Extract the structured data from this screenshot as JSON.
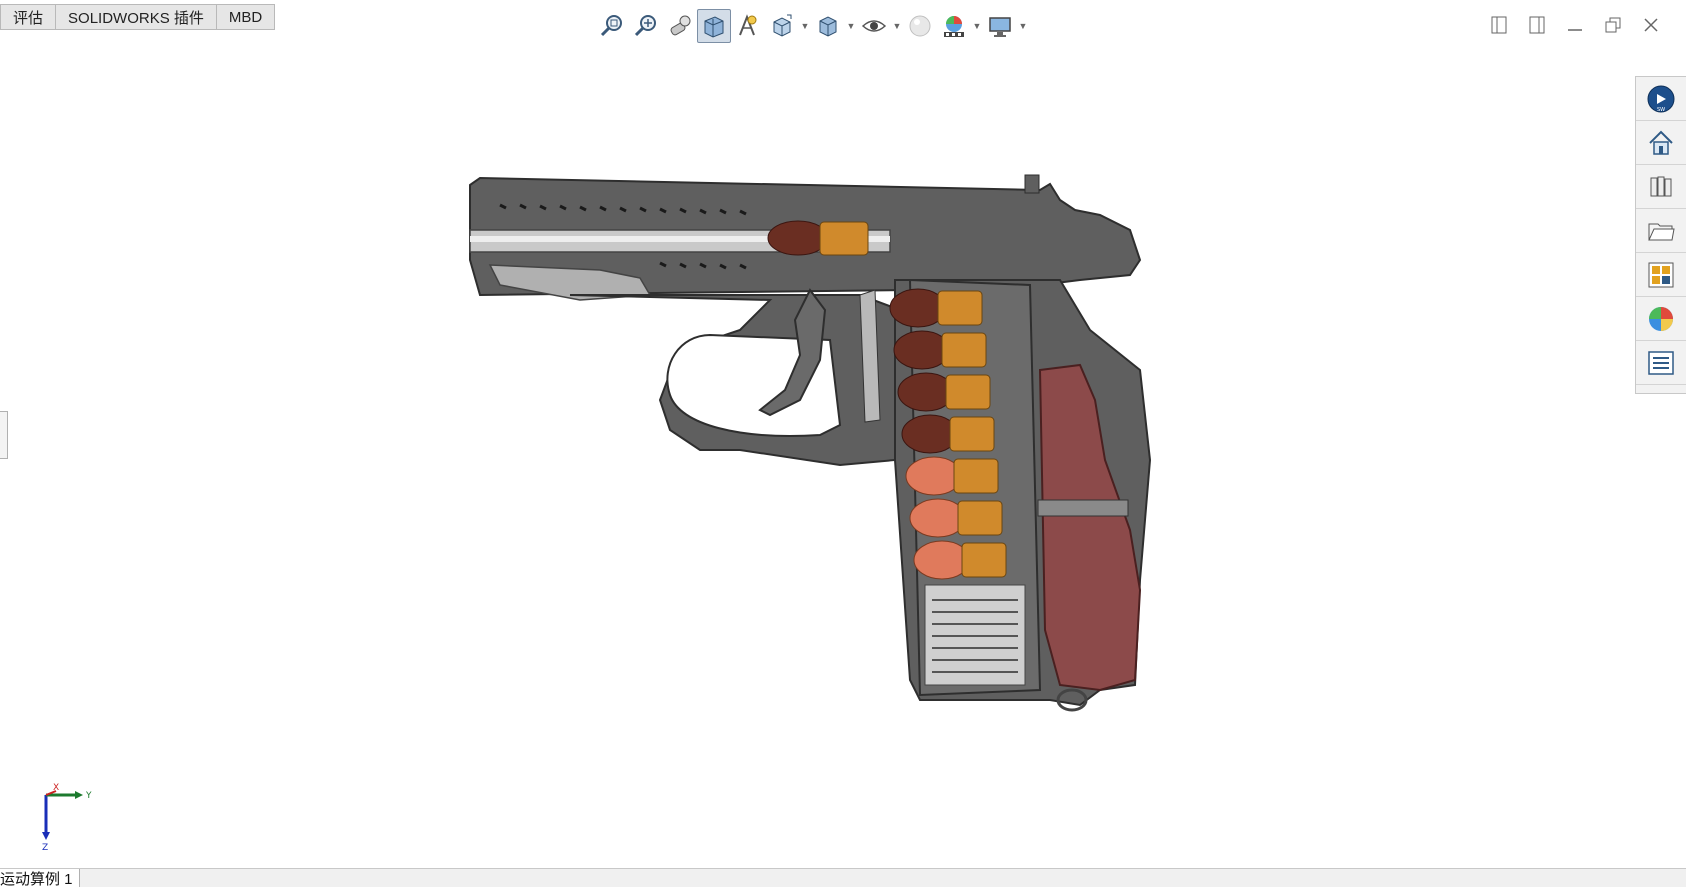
{
  "tabs": [
    {
      "label": "评估"
    },
    {
      "label": "SOLIDWORKS 插件"
    },
    {
      "label": "MBD"
    }
  ],
  "hud_toolbar": {
    "items": [
      {
        "icon": "zoom-to-fit-icon"
      },
      {
        "icon": "zoom-to-area-icon"
      },
      {
        "icon": "previous-view-icon"
      },
      {
        "icon": "section-view-icon",
        "active": true
      },
      {
        "icon": "dynamic-annotation-views-icon"
      },
      {
        "icon": "view-orientation-icon",
        "has_dropdown": true
      },
      {
        "icon": "display-style-icon",
        "has_dropdown": true
      },
      {
        "icon": "hide-show-items-icon",
        "has_dropdown": true
      },
      {
        "icon": "edit-appearance-icon"
      },
      {
        "icon": "apply-scene-icon",
        "has_dropdown": true
      },
      {
        "icon": "view-settings-icon",
        "has_dropdown": true
      }
    ]
  },
  "window_controls": [
    "tile-left-icon",
    "tile-right-icon",
    "minimize-icon",
    "restore-icon",
    "close-icon"
  ],
  "task_pane": {
    "items": [
      "solidworks-resources-icon",
      "home-icon",
      "design-library-icon",
      "file-explorer-icon",
      "view-palette-icon",
      "appearances-scenes-icon",
      "custom-properties-icon"
    ]
  },
  "triad": {
    "x": "X",
    "y": "Y",
    "z": "Z"
  },
  "bottom_tab": {
    "label": "运动算例 1"
  },
  "colors": {
    "frame": "#5a5a5a",
    "grip": "#8c4a4a",
    "bullet_dark": "#6a2e22",
    "bullet_light": "#e07a5c",
    "casing": "#d08a2c",
    "accent_blue": "#2b7bd8"
  }
}
